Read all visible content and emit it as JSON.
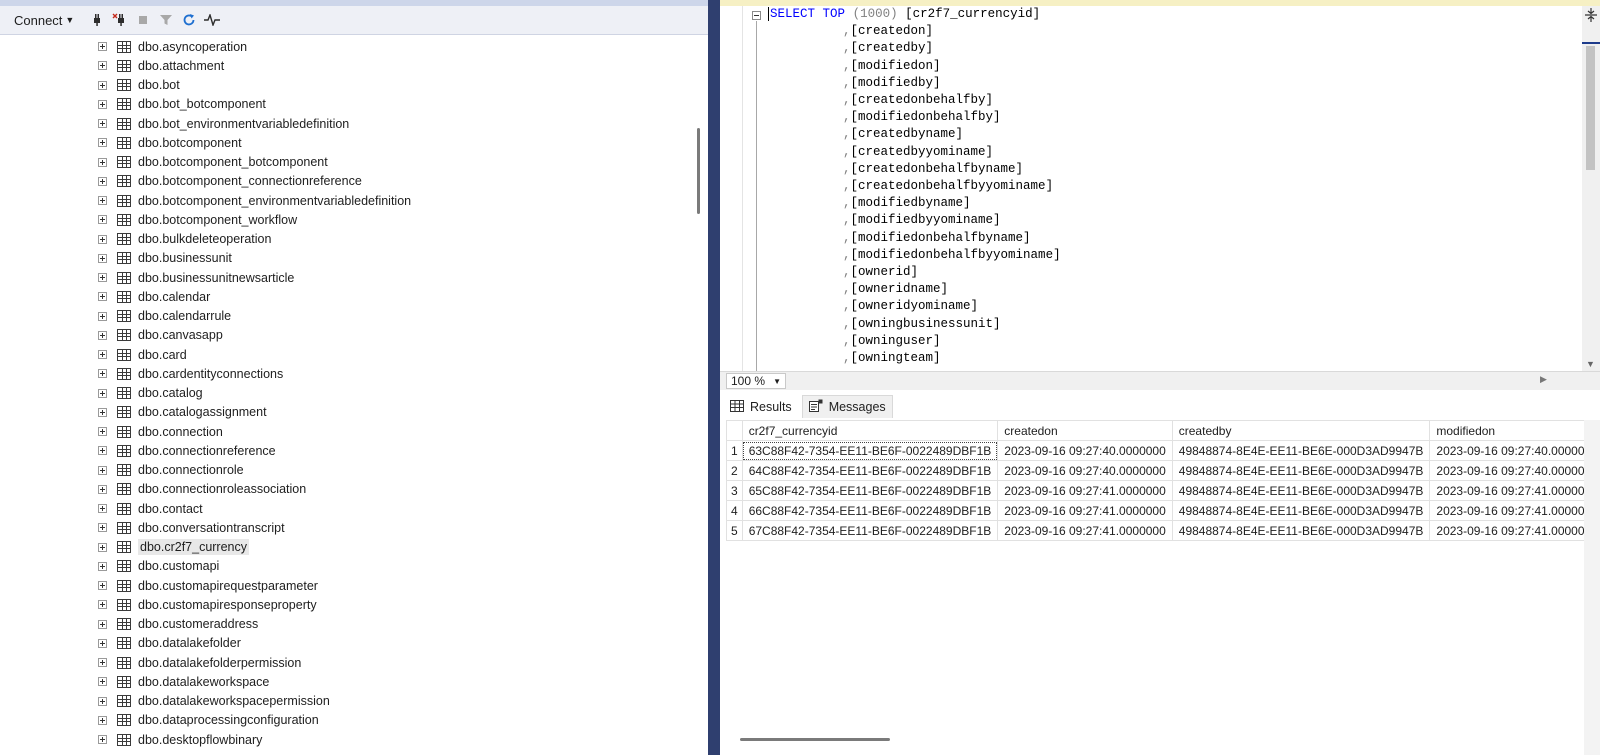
{
  "toolbar": {
    "connect_label": "Connect",
    "icons": [
      "connect-plug-icon",
      "disconnect-icon",
      "stop-icon",
      "filter-icon",
      "refresh-icon",
      "activity-monitor-icon"
    ]
  },
  "tree": {
    "items": [
      "dbo.asyncoperation",
      "dbo.attachment",
      "dbo.bot",
      "dbo.bot_botcomponent",
      "dbo.bot_environmentvariabledefinition",
      "dbo.botcomponent",
      "dbo.botcomponent_botcomponent",
      "dbo.botcomponent_connectionreference",
      "dbo.botcomponent_environmentvariabledefinition",
      "dbo.botcomponent_workflow",
      "dbo.bulkdeleteoperation",
      "dbo.businessunit",
      "dbo.businessunitnewsarticle",
      "dbo.calendar",
      "dbo.calendarrule",
      "dbo.canvasapp",
      "dbo.card",
      "dbo.cardentityconnections",
      "dbo.catalog",
      "dbo.catalogassignment",
      "dbo.connection",
      "dbo.connectionreference",
      "dbo.connectionrole",
      "dbo.connectionroleassociation",
      "dbo.contact",
      "dbo.conversationtranscript",
      "dbo.cr2f7_currency",
      "dbo.customapi",
      "dbo.customapirequestparameter",
      "dbo.customapiresponseproperty",
      "dbo.customeraddress",
      "dbo.datalakefolder",
      "dbo.datalakefolderpermission",
      "dbo.datalakeworkspace",
      "dbo.datalakeworkspacepermission",
      "dbo.dataprocessingconfiguration",
      "dbo.desktopflowbinary"
    ],
    "selected_index": 26
  },
  "editor": {
    "first_line": {
      "kw1": "SELECT",
      "kw2": "TOP",
      "paren": "(1000)",
      "column": "[cr2f7_currencyid]"
    },
    "columns": [
      "[createdon]",
      "[createdby]",
      "[modifiedon]",
      "[modifiedby]",
      "[createdonbehalfby]",
      "[modifiedonbehalfby]",
      "[createdbyname]",
      "[createdbyyominame]",
      "[createdonbehalfbyname]",
      "[createdonbehalfbyyominame]",
      "[modifiedbyname]",
      "[modifiedbyyominame]",
      "[modifiedonbehalfbyname]",
      "[modifiedonbehalfbyyominame]",
      "[ownerid]",
      "[owneridname]",
      "[owneridyominame]",
      "[owningbusinessunit]",
      "[owninguser]",
      "[owningteam]"
    ],
    "comma": ","
  },
  "zoom": {
    "value": "100 %"
  },
  "results": {
    "tabs": {
      "results_label": "Results",
      "messages_label": "Messages"
    },
    "headers": [
      "cr2f7_currencyid",
      "createdon",
      "createdby",
      "modifiedon"
    ],
    "rows": [
      {
        "n": "1",
        "c1": "63C88F42-7354-EE11-BE6F-0022489DBF1B",
        "c2": "2023-09-16 09:27:40.0000000",
        "c3": "49848874-8E4E-EE11-BE6E-000D3AD9947B",
        "c4": "2023-09-16 09:27:40.00000"
      },
      {
        "n": "2",
        "c1": "64C88F42-7354-EE11-BE6F-0022489DBF1B",
        "c2": "2023-09-16 09:27:40.0000000",
        "c3": "49848874-8E4E-EE11-BE6E-000D3AD9947B",
        "c4": "2023-09-16 09:27:40.00000"
      },
      {
        "n": "3",
        "c1": "65C88F42-7354-EE11-BE6F-0022489DBF1B",
        "c2": "2023-09-16 09:27:41.0000000",
        "c3": "49848874-8E4E-EE11-BE6E-000D3AD9947B",
        "c4": "2023-09-16 09:27:41.00000"
      },
      {
        "n": "4",
        "c1": "66C88F42-7354-EE11-BE6F-0022489DBF1B",
        "c2": "2023-09-16 09:27:41.0000000",
        "c3": "49848874-8E4E-EE11-BE6E-000D3AD9947B",
        "c4": "2023-09-16 09:27:41.00000"
      },
      {
        "n": "5",
        "c1": "67C88F42-7354-EE11-BE6F-0022489DBF1B",
        "c2": "2023-09-16 09:27:41.0000000",
        "c3": "49848874-8E4E-EE11-BE6E-000D3AD9947B",
        "c4": "2023-09-16 09:27:41.00000"
      }
    ]
  },
  "colors": {
    "keyword": "#0000ff",
    "frame": "#2f3f6f",
    "refresh": "#1e6fd0"
  }
}
